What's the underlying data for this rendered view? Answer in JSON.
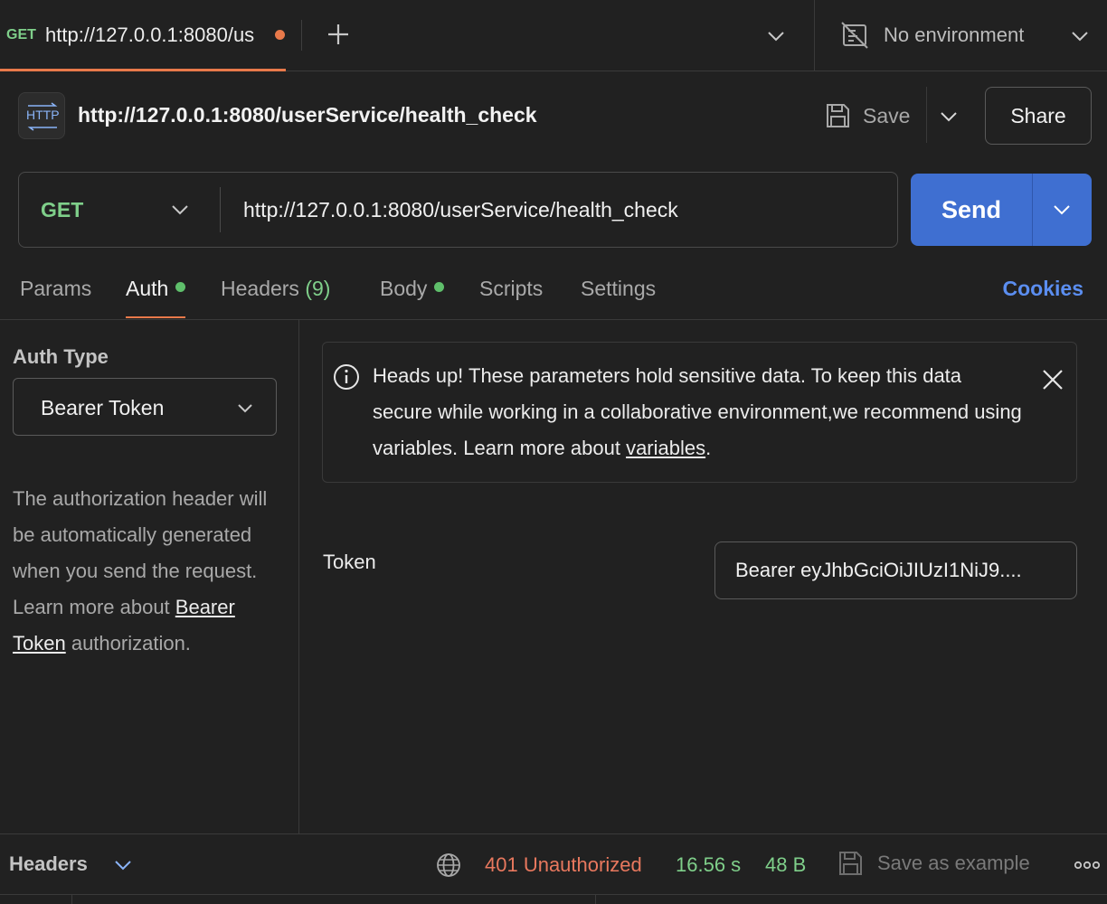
{
  "tab": {
    "method": "GET",
    "url": "http://127.0.0.1:8080/us",
    "unsaved_dot_color": "#e8794a"
  },
  "environment": {
    "icon": "no-environment-icon",
    "label": "No environment"
  },
  "request": {
    "type_icon": "http-icon",
    "title": "http://127.0.0.1:8080/userService/health_check",
    "save_label": "Save",
    "share_label": "Share",
    "method": "GET",
    "url": "http://127.0.0.1:8080/userService/health_check",
    "send_label": "Send"
  },
  "subtabs": {
    "params": "Params",
    "auth": "Auth",
    "headers": "Headers",
    "headers_count": "(9)",
    "body": "Body",
    "scripts": "Scripts",
    "settings": "Settings",
    "cookies": "Cookies"
  },
  "auth": {
    "type_label": "Auth Type",
    "type_value": "Bearer Token",
    "desc_before": "The authorization header will be automatically generated when you send the request. Learn more about ",
    "desc_link": "Bearer Token",
    "desc_after": " authorization.",
    "notice_before": "Heads up! These parameters hold sensitive data. To keep this data secure while working in a collaborative environment,we recommend using variables. Learn more about ",
    "notice_link": "variables",
    "notice_after": ".",
    "token_label": "Token",
    "token_value": "Bearer eyJhbGciOiJIUzI1NiJ9...."
  },
  "response": {
    "headers_label": "Headers",
    "status": "401 Unauthorized",
    "time": "16.56 s",
    "size": "48 B",
    "save_example_label": "Save as example"
  },
  "colors": {
    "accent_orange": "#e8794a",
    "method_green": "#7fcf8a",
    "send_blue": "#3f6fd1",
    "cookies_blue": "#5b8ef0",
    "status_error": "#e8785e"
  }
}
